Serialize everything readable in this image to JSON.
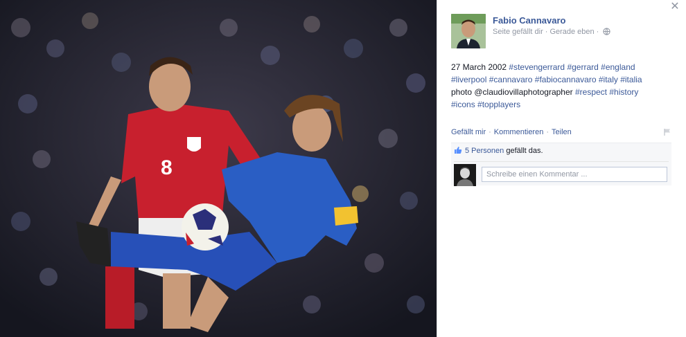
{
  "photo": {
    "description_icon": "football-match-photo",
    "shirt_number": "8"
  },
  "post": {
    "author": "Fabio Cannavaro",
    "meta_liked": "Seite gefällt dir",
    "meta_time": "Gerade eben",
    "text_plain_start": "27 March 2002 ",
    "hashtags_line1": [
      "#stevengerrard",
      "#gerrard",
      "#england"
    ],
    "hashtags_line2": [
      "#liverpool",
      "#cannavaro",
      "#fabiocannavaro",
      "#italy",
      "#italia"
    ],
    "text_plain_line3": "photo @claudiovillaphotographer ",
    "hashtags_line3": [
      "#respect",
      "#history"
    ],
    "hashtags_line4": [
      "#icons",
      "#topplayers"
    ]
  },
  "actions": {
    "like": "Gefällt mir",
    "comment": "Kommentieren",
    "share": "Teilen"
  },
  "likes": {
    "count": "5 Personen",
    "rest": "gefällt das."
  },
  "comment": {
    "placeholder": "Schreibe einen Kommentar ..."
  },
  "colors": {
    "link": "#3b5998",
    "muted": "#9197a3",
    "england_red": "#c8202e",
    "italy_blue": "#2a5ec4",
    "armband": "#f2c230"
  }
}
